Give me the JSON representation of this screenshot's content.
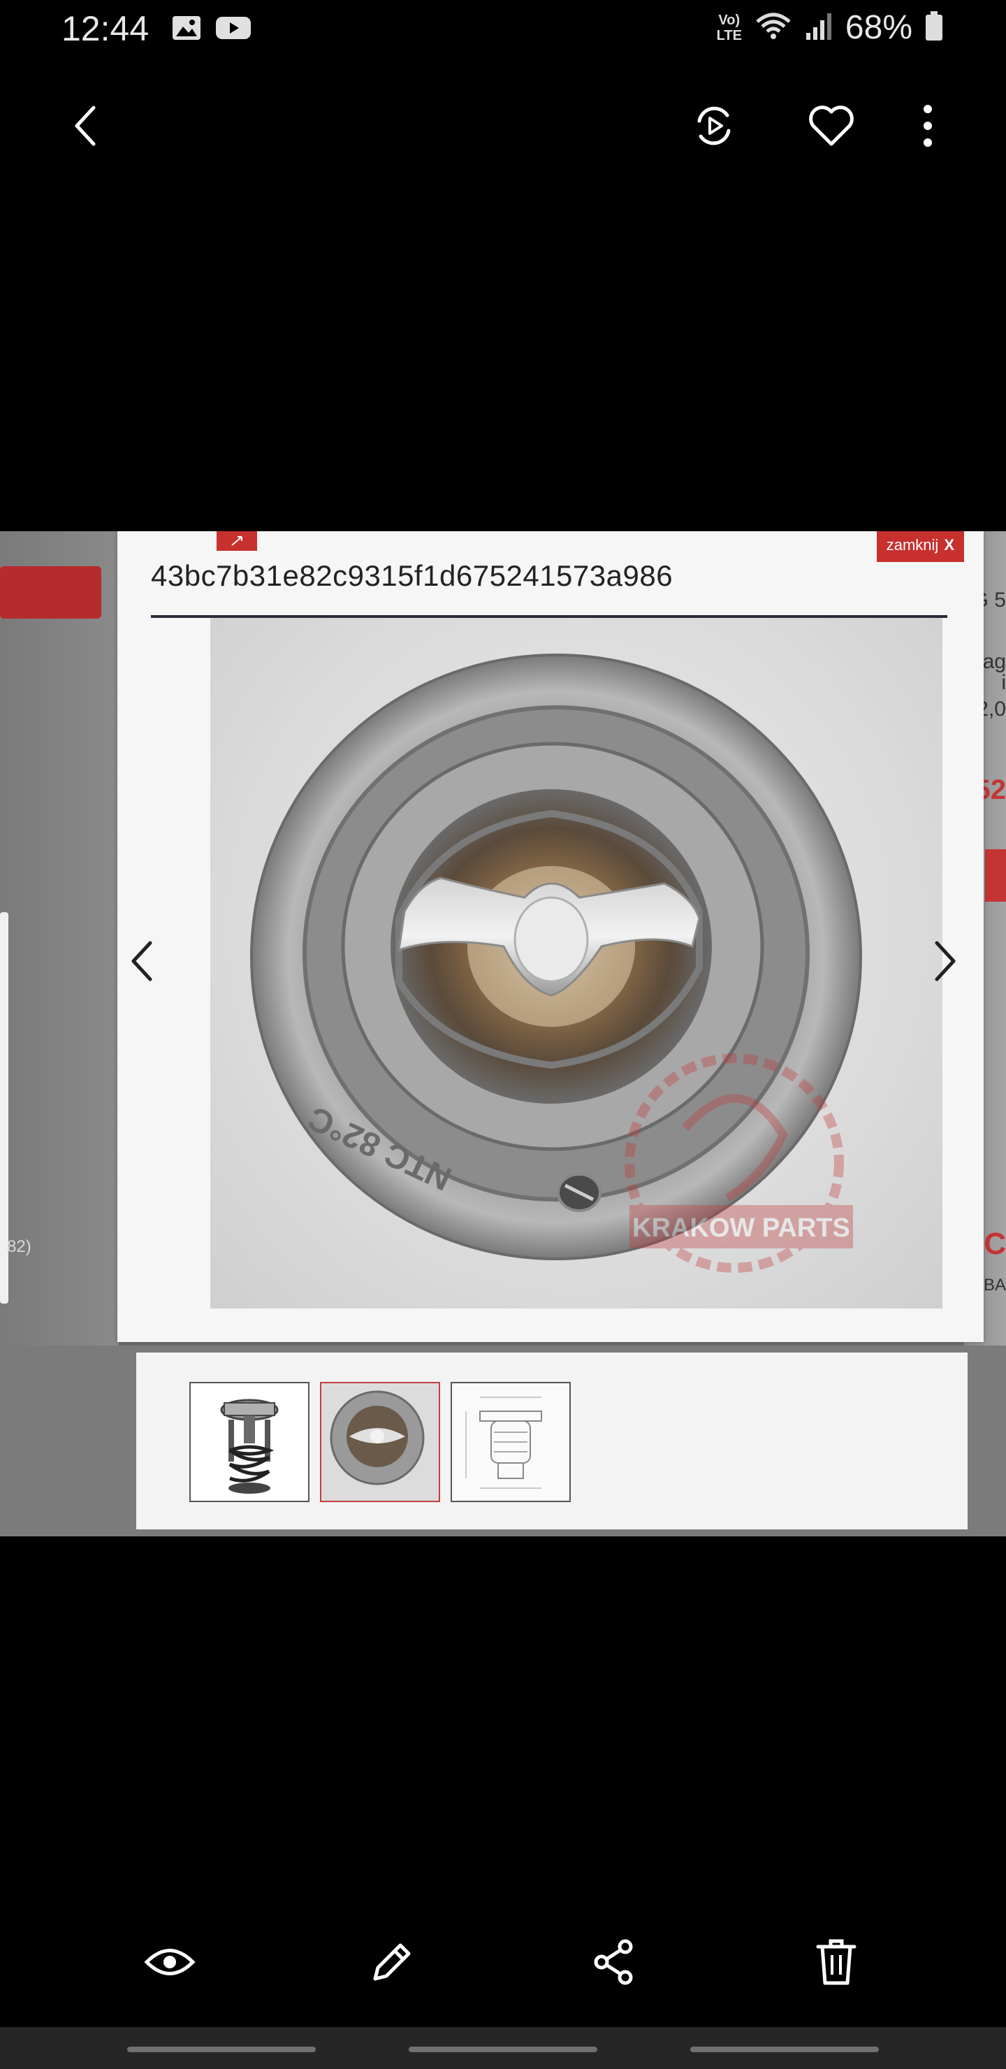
{
  "status_bar": {
    "time": "12:44",
    "network": "Vo)) LTE",
    "battery_percent": "68%",
    "notification_icons": [
      "gallery-icon",
      "youtube-icon"
    ],
    "signal_icons": [
      "wifi-icon",
      "signal-icon",
      "battery-icon"
    ]
  },
  "top_bar": {
    "actions": [
      "back-icon",
      "motion-play-icon",
      "favorite-heart-icon",
      "more-options-icon"
    ]
  },
  "photo": {
    "lightbox": {
      "title": "43bc7b31e82c9315f1d675241573a986",
      "close_label": "zamknij",
      "close_symbol": "X",
      "main_image_stamp": "NTC 82°C",
      "watermark": "KRAKOW PARTS",
      "thumbnails": [
        {
          "name": "thermostat-side-view",
          "selected": false
        },
        {
          "name": "thermostat-top-view",
          "selected": true
        },
        {
          "name": "thermostat-technical-drawing",
          "selected": false
        }
      ]
    },
    "background_fragments": {
      "left_text": "82)",
      "right_text": [
        "G 5",
        "ag",
        "i",
        "2,0",
        "52",
        "C",
        "BA"
      ]
    }
  },
  "bottom_bar": {
    "actions": [
      "view-eye-icon",
      "edit-pencil-icon",
      "share-icon",
      "delete-trash-icon"
    ]
  },
  "colors": {
    "background": "#000000",
    "accent_red": "#c8302e",
    "lightbox_bg": "#f6f6f6"
  }
}
